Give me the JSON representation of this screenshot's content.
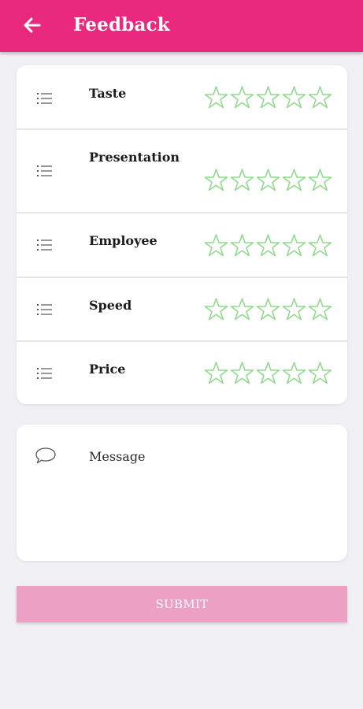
{
  "appbar": {
    "title": "Feedback",
    "back_icon": "arrow-left-icon",
    "color": "#e8297e"
  },
  "ratings": {
    "item_icon": "list-icon",
    "star_icon": "star-outline-icon",
    "star_color": "#8fd98a",
    "items": [
      {
        "label": "Taste",
        "rating": 0,
        "max": 5
      },
      {
        "label": "Presentation",
        "rating": 0,
        "max": 5
      },
      {
        "label": "Employee",
        "rating": 0,
        "max": 5
      },
      {
        "label": "Speed",
        "rating": 0,
        "max": 5
      },
      {
        "label": "Price",
        "rating": 0,
        "max": 5
      }
    ]
  },
  "message": {
    "icon": "chat-bubble-icon",
    "placeholder": "Message",
    "value": ""
  },
  "submit": {
    "label": "SUBMIT",
    "color": "#eba0c4"
  }
}
